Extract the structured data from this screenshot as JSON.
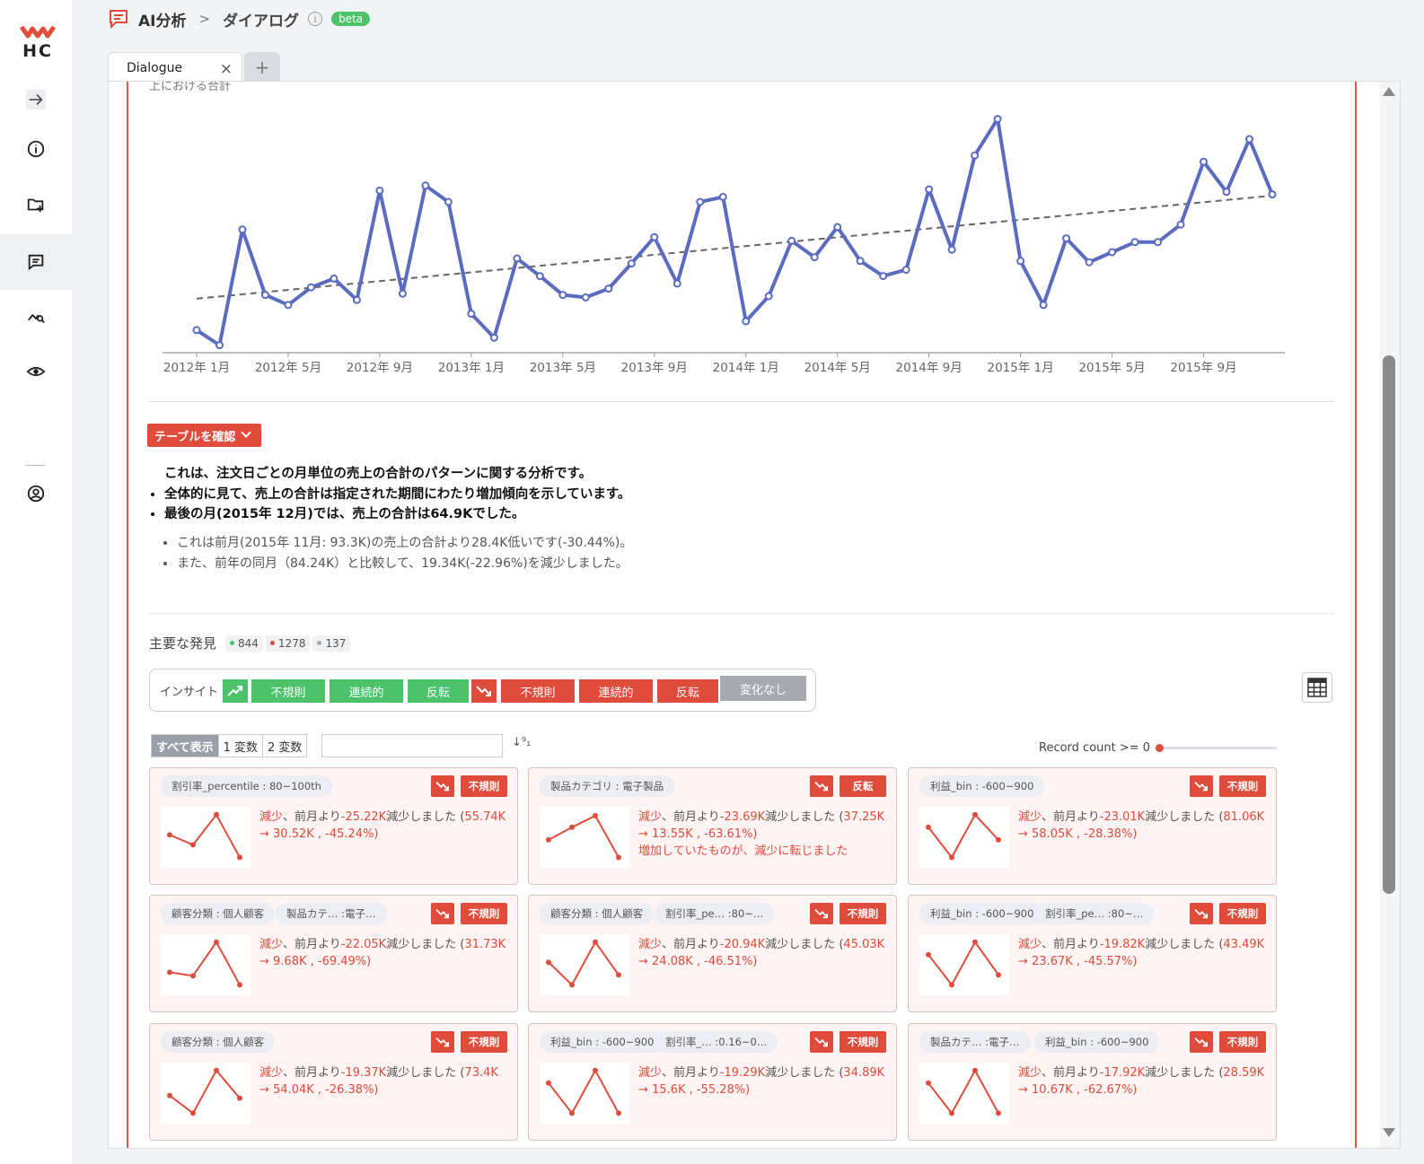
{
  "app": {
    "title": "AI分析",
    "breadcrumb_sep": ">",
    "subtitle": "ダイアログ",
    "info_glyph": "i",
    "badge": "beta"
  },
  "sidebar": {
    "logo_text": "HC",
    "items": [
      "arrow-right-icon",
      "info-icon",
      "folder-add-icon",
      "chat-icon",
      "chart-search-icon",
      "eye-icon",
      "user-icon"
    ],
    "active": "chat-icon"
  },
  "tabs": [
    {
      "label": "Dialogue",
      "close": "×"
    }
  ],
  "tab_add": "+",
  "chart_data": {
    "type": "line",
    "title_fragment": "上における合計",
    "x_tick_labels": [
      "2012年 1月",
      "2012年 5月",
      "2012年 9月",
      "2013年 1月",
      "2013年 5月",
      "2013年 9月",
      "2014年 1月",
      "2014年 5月",
      "2014年 9月",
      "2015年 1月",
      "2015年 5月",
      "2015年 9月"
    ],
    "x": [
      "2012-01",
      "2012-02",
      "2012-03",
      "2012-04",
      "2012-05",
      "2012-06",
      "2012-07",
      "2012-08",
      "2012-09",
      "2012-10",
      "2012-11",
      "2012-12",
      "2013-01",
      "2013-02",
      "2013-03",
      "2013-04",
      "2013-05",
      "2013-06",
      "2013-07",
      "2013-08",
      "2013-09",
      "2013-10",
      "2013-11",
      "2013-12",
      "2014-01",
      "2014-02",
      "2014-03",
      "2014-04",
      "2014-05",
      "2014-06",
      "2014-07",
      "2014-08",
      "2014-09",
      "2014-10",
      "2014-11",
      "2014-12",
      "2015-01",
      "2015-02",
      "2015-03",
      "2015-04",
      "2015-05",
      "2015-06",
      "2015-07",
      "2015-08",
      "2015-09",
      "2015-10",
      "2015-11",
      "2015-12"
    ],
    "series": [
      {
        "values": [
          18,
          6,
          98,
          46,
          38,
          52,
          59,
          42,
          129,
          47,
          133,
          120,
          31,
          12,
          75,
          61,
          46,
          44,
          51,
          71,
          92,
          55,
          120,
          124,
          25,
          45,
          89,
          76,
          100,
          73,
          61,
          66,
          130,
          82,
          157,
          186,
          73,
          38,
          91,
          72,
          80,
          88,
          88,
          102,
          152,
          128,
          170,
          126
        ],
        "color": "#5a6bc0"
      },
      {
        "values": [
          43,
          125
        ],
        "style": "dashed-trend",
        "color": "#666666"
      }
    ],
    "ylim": [
      0,
      200
    ],
    "grid": false
  },
  "table_button": "テーブルを確認",
  "summary": {
    "lead": "これは、注文日ごとの月単位の売上の合計のパターンに関する分析です。",
    "bullets": [
      "全体的に見て、売上の合計は指定された期間にわたり増加傾向を示しています。",
      "最後の月(2015年 12月)では、売上の合計は64.9Kでした。"
    ],
    "sub_bullets": [
      "これは前月(2015年 11月: 93.3K)の売上の合計より28.4K低いです(-30.44%)。",
      "また、前年の同月（84.24K）と比較して、19.34K(-22.96%)を減少しました。"
    ]
  },
  "findings": {
    "heading": "主要な発見",
    "counts": [
      {
        "value": "844",
        "color": "#4cc36b"
      },
      {
        "value": "1278",
        "color": "#e04c3c"
      },
      {
        "value": "137",
        "color": "#a7aab1"
      }
    ]
  },
  "insights": {
    "label": "インサイト",
    "up_buttons": [
      "不規則",
      "連続的",
      "反転"
    ],
    "down_buttons": [
      "不規則",
      "連続的",
      "反転"
    ],
    "neutral": "変化なし"
  },
  "filters": {
    "segments": [
      "すべて表示",
      "1 変数",
      "2 変数"
    ],
    "search_value": "",
    "sort_glyph": "↓⁹₁",
    "record_label": "Record count >= 0",
    "record_min": 0
  },
  "cards": [
    {
      "chips": [
        "割引率_percentile : 80~100th"
      ],
      "badge": "不規則",
      "line1": "減少",
      "line2": "、前月より",
      "delta": "-25.22K",
      "line3": "減少しました (",
      "from": "55.74K",
      "to": "→ 30.52K , -45.24%)",
      "extra": "",
      "spark": [
        0.55,
        0.35,
        0.95,
        0.1
      ]
    },
    {
      "chips": [
        "製品カテゴリ : 電子製品"
      ],
      "badge": "反転",
      "line1": "減少",
      "line2": "、前月より",
      "delta": "-23.69K",
      "line3": "減少しました (",
      "from": "37.25K",
      "to": "→ 13.55K , -63.61%)",
      "extra": "増加していたものが、減少に転じました",
      "spark": [
        0.45,
        0.7,
        0.93,
        0.1
      ]
    },
    {
      "chips": [
        "利益_bin : -600~900"
      ],
      "badge": "不規則",
      "line1": "減少",
      "line2": "、前月より",
      "delta": "-23.01K",
      "line3": "減少しました (",
      "from": "81.06K",
      "to": "→ 58.05K , -28.38%)",
      "extra": "",
      "spark": [
        0.7,
        0.1,
        0.95,
        0.45
      ]
    },
    {
      "chips": [
        "顧客分類 : 個人顧客",
        "製品カテ… :電子…"
      ],
      "badge": "不規則",
      "line1": "減少",
      "line2": "、前月より",
      "delta": "-22.05K",
      "line3": "減少しました (",
      "from": "31.73K",
      "to": "→ 9.68K , -69.49%)",
      "extra": "",
      "spark": [
        0.35,
        0.28,
        0.95,
        0.1
      ]
    },
    {
      "chips": [
        "顧客分類 : 個人顧客",
        "割引率_pe… :80~…"
      ],
      "badge": "不規則",
      "line1": "減少",
      "line2": "、前月より",
      "delta": "-20.94K",
      "line3": "減少しました (",
      "from": "45.03K",
      "to": "→ 24.08K , -46.51%)",
      "extra": "",
      "spark": [
        0.55,
        0.1,
        0.95,
        0.3
      ]
    },
    {
      "chips": [
        "利益_bin : -600~900",
        "割引率_pe… :80~…"
      ],
      "badge": "不規則",
      "line1": "減少",
      "line2": "、前月より",
      "delta": "-19.82K",
      "line3": "減少しました (",
      "from": "43.49K",
      "to": "→ 23.67K , -45.57%)",
      "extra": "",
      "spark": [
        0.7,
        0.1,
        0.95,
        0.3
      ]
    },
    {
      "chips": [
        "顧客分類 : 個人顧客"
      ],
      "badge": "不規則",
      "line1": "減少",
      "line2": "、前月より",
      "delta": "-19.37K",
      "line3": "減少しました (",
      "from": "73.4K",
      "to": "→ 54.04K , -26.38%)",
      "extra": "",
      "spark": [
        0.45,
        0.1,
        0.95,
        0.4
      ]
    },
    {
      "chips": [
        "利益_bin : -600~900",
        "割引率_… :0.16~0…"
      ],
      "badge": "不規則",
      "line1": "減少",
      "line2": "、前月より",
      "delta": "-19.29K",
      "line3": "減少しました (",
      "from": "34.89K",
      "to": "→ 15.6K , -55.28%)",
      "extra": "",
      "spark": [
        0.7,
        0.1,
        0.95,
        0.1
      ]
    },
    {
      "chips": [
        "製品カテ… :電子…",
        "利益_bin : -600~900"
      ],
      "badge": "不規則",
      "line1": "減少",
      "line2": "、前月より",
      "delta": "-17.92K",
      "line3": "減少しました (",
      "from": "28.59K",
      "to": "→ 10.67K , -62.67%)",
      "extra": "",
      "spark": [
        0.7,
        0.1,
        0.95,
        0.1
      ]
    }
  ],
  "colors": {
    "accent_red": "#e04c3c",
    "accent_green": "#4cc36b",
    "line_blue": "#5a6bc0",
    "neutral": "#a7aab1"
  }
}
